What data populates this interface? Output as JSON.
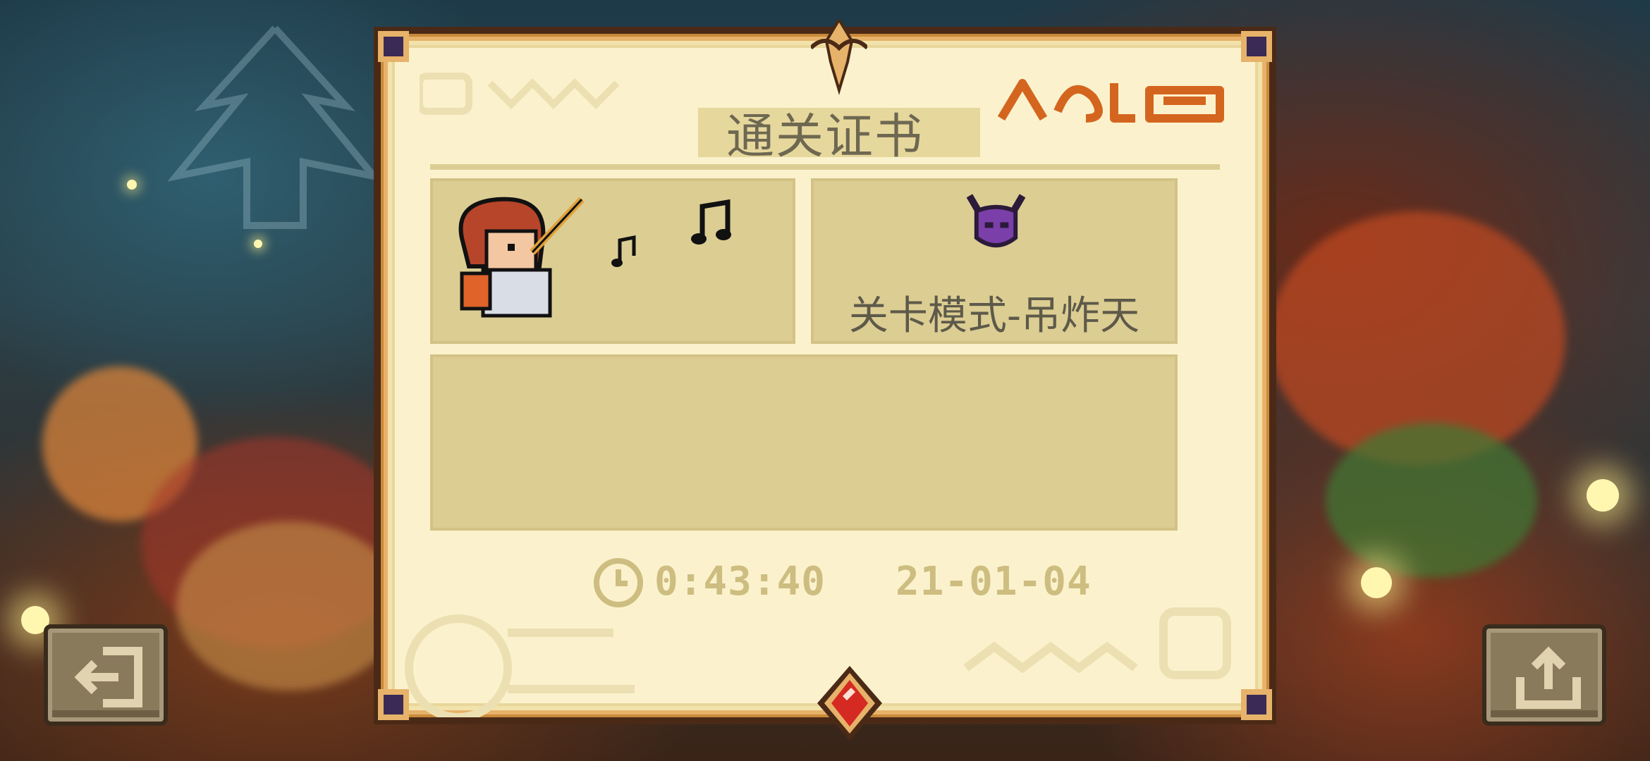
{
  "certificate": {
    "title": "通关证书",
    "mode_label": "关卡模式-吊炸天",
    "time": "0:43:40",
    "date": "21-01-04"
  },
  "icons": {
    "hero": "red-haired-bard-hero-icon",
    "boss": "purple-horned-demon-icon",
    "clock": "clock-icon",
    "gem": "red-gem-icon",
    "exit": "exit-icon",
    "share": "share-icon",
    "notes": "music-note-icon"
  },
  "buttons": {
    "exit": "exit",
    "share": "share"
  },
  "colors": {
    "paper": "#fbf2cd",
    "panel": "#dccd93",
    "frame": "#e7b26a",
    "accent_orange": "#d4651f",
    "text": "#5e5a4a",
    "stat_text": "#cdbd80"
  }
}
